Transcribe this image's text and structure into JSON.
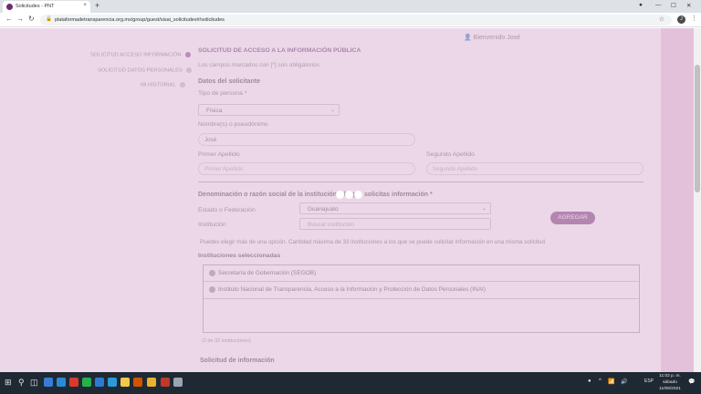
{
  "browser": {
    "tab_title": "Solicitudes - PNT",
    "tab_close": "×",
    "new_tab": "+",
    "url": "plataformadetransparencia.org.mx/group/guest/sisai_solicitudes#/solicitudes",
    "back": "←",
    "forward": "→",
    "reload": "↻",
    "lock": "🔒",
    "star": "☆",
    "profile_initial": "J",
    "menu": "⋮",
    "minimize": "—",
    "maximize": "☐",
    "close": "✕"
  },
  "header": {
    "welcome": "Bienvenido José",
    "user_icon": "👤"
  },
  "sidebar": {
    "items": [
      {
        "label": "Solicitud acceso información",
        "active": true
      },
      {
        "label": "Solicitud datos personales",
        "active": false
      },
      {
        "label": "Mi historial",
        "active": false
      }
    ]
  },
  "form": {
    "title": "Solicitud de acceso a la información pública",
    "required_note": "Los campos marcados con [*] son obligatorios",
    "requester_section": "Datos del solicitante",
    "person_type_label": "Tipo de persona *",
    "person_type_value": "Física",
    "name_label": "Nombre(s) o pseudónimo",
    "name_value": "José",
    "first_surname_label": "Primer Apellido",
    "first_surname_placeholder": "Primer Apellido",
    "second_surname_label": "Segundo Apellido",
    "second_surname_placeholder": "Segundo Apellido",
    "institution_section": "Denominación o razón social de la institución a la que solicitas información *",
    "state_label": "Estado o Federación",
    "state_value": "Guanajuato",
    "institution_label": "Institución",
    "institution_placeholder": "Buscar institución",
    "add_button": "Agregar",
    "help_text": "Puedes elegir más de una opción. Cantidad máxima de 33 instituciones a los que se puede solicitar información en una misma solicitud",
    "selected_label": "Instituciones seleccionadas",
    "selected_institutions": [
      "Secretaría de Gobernación (SEGOB)",
      "Instituto Nacional de Transparencia, Acceso a la Información y Protección de Datos Personales (INAI)"
    ],
    "count_text": "(2 de 33 instituciones)",
    "request_section": "Solicitud de información",
    "chevron": "⌄"
  },
  "taskbar": {
    "start": "⊞",
    "search": "⚲",
    "task_view": "◫",
    "time": "11:02 p. m.",
    "day": "sábado",
    "date": "11/09/2021",
    "lang": "ESP",
    "tray_up": "^",
    "volume": "🔊",
    "wifi": "📶",
    "notifications": "💬"
  },
  "colors": {
    "accent": "#6b2b6e",
    "overlay": "#e0beda",
    "taskbar": "#1f2933"
  }
}
